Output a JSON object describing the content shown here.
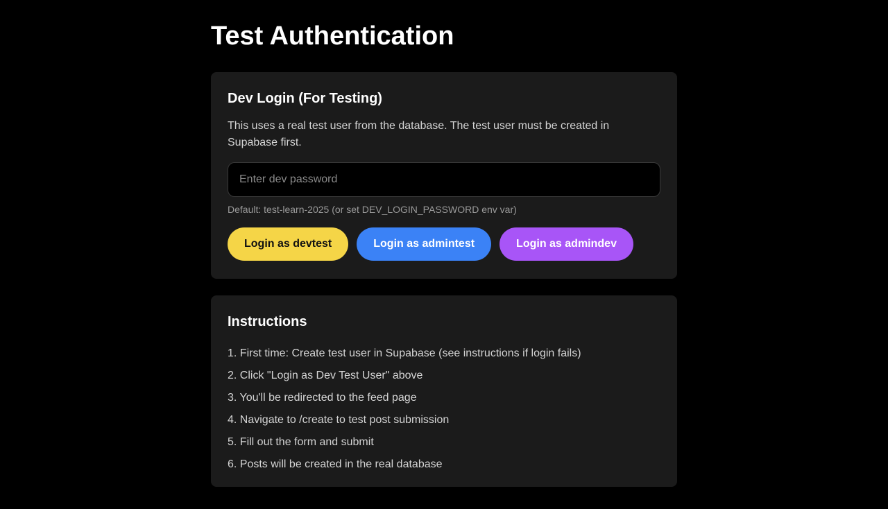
{
  "page": {
    "title": "Test Authentication"
  },
  "dev_login": {
    "title": "Dev Login (For Testing)",
    "description": "This uses a real test user from the database. The test user must be created in Supabase first.",
    "password_input": {
      "placeholder": "Enter dev password",
      "value": ""
    },
    "hint": "Default: test-learn-2025 (or set DEV_LOGIN_PASSWORD env var)",
    "buttons": [
      {
        "label": "Login as devtest",
        "color": "#f5d547"
      },
      {
        "label": "Login as admintest",
        "color": "#3b82f6"
      },
      {
        "label": "Login as admindev",
        "color": "#a855f7"
      }
    ]
  },
  "instructions": {
    "title": "Instructions",
    "steps": [
      "1. First time: Create test user in Supabase (see instructions if login fails)",
      "2. Click \"Login as Dev Test User\" above",
      "3. You'll be redirected to the feed page",
      "4. Navigate to /create to test post submission",
      "5. Fill out the form and submit",
      "6. Posts will be created in the real database"
    ]
  }
}
